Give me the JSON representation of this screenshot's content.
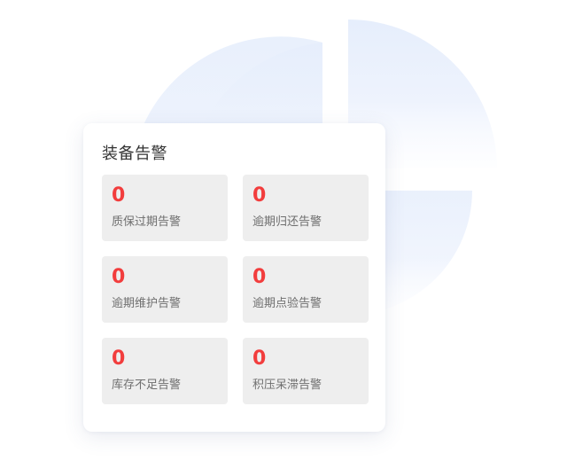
{
  "panel": {
    "title": "装备告警",
    "alert_color": "#f23d3d",
    "items": [
      {
        "count": "0",
        "label": "质保过期告警"
      },
      {
        "count": "0",
        "label": "逾期归还告警"
      },
      {
        "count": "0",
        "label": "逾期维护告警"
      },
      {
        "count": "0",
        "label": "逾期点验告警"
      },
      {
        "count": "0",
        "label": "库存不足告警"
      },
      {
        "count": "0",
        "label": "积压呆滞告警"
      }
    ]
  }
}
